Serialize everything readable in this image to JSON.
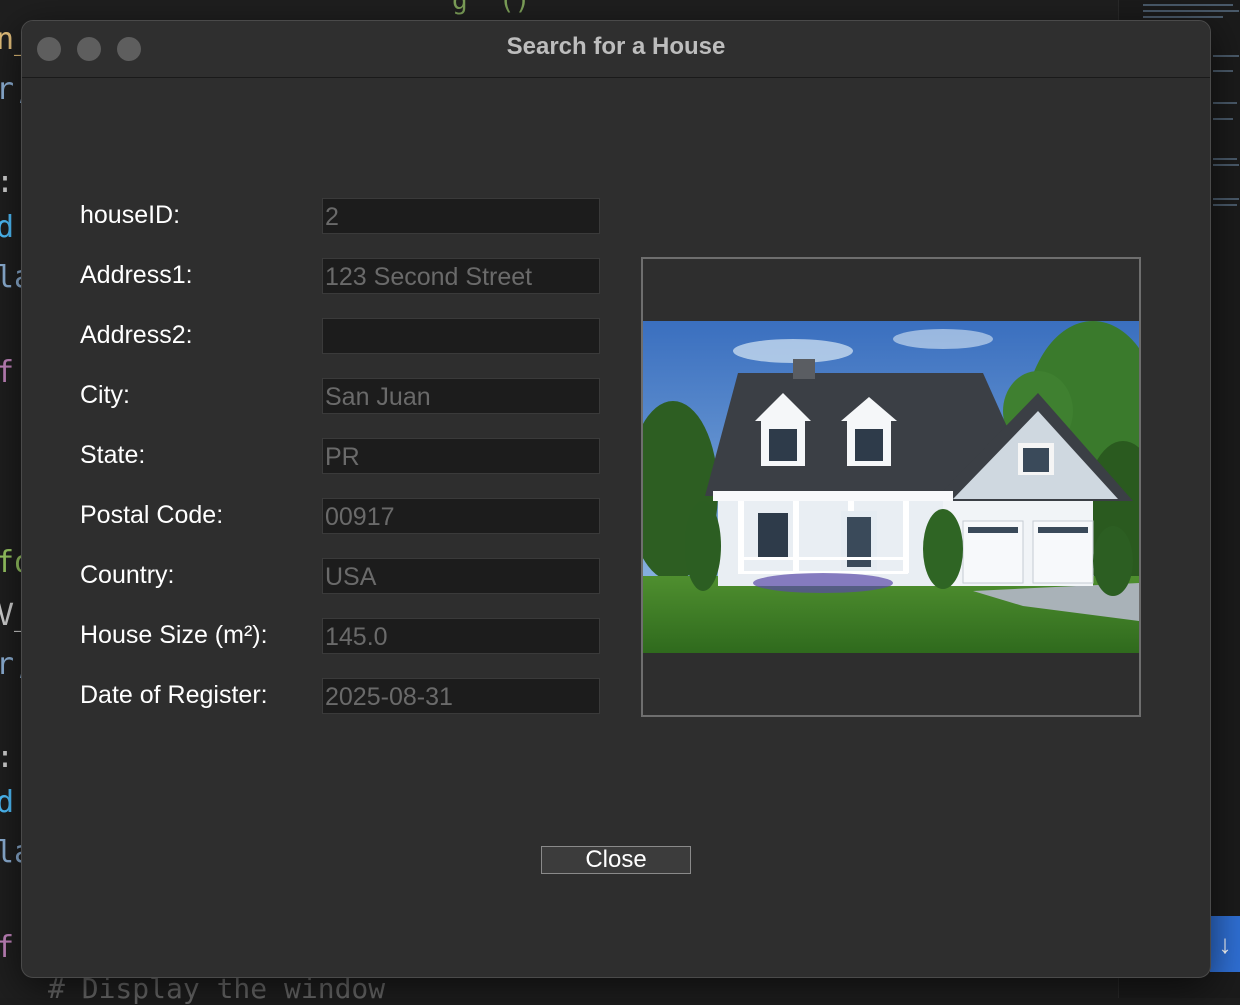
{
  "window": {
    "title": "Search for a House"
  },
  "form": {
    "fields": [
      {
        "label": "houseID:",
        "value": "2"
      },
      {
        "label": "Address1:",
        "value": "123 Second Street"
      },
      {
        "label": "Address2:",
        "value": ""
      },
      {
        "label": "City:",
        "value": "San Juan"
      },
      {
        "label": "State:",
        "value": "PR"
      },
      {
        "label": "Postal Code:",
        "value": "00917"
      },
      {
        "label": "Country:",
        "value": "USA"
      },
      {
        "label": "House Size (m²):",
        "value": "145.0"
      },
      {
        "label": "Date of Register:",
        "value": "2025-08-31"
      }
    ]
  },
  "buttons": {
    "close": "Close"
  },
  "background_editor": {
    "bottom_code": "# Display the window",
    "top_code": "g  ()",
    "scroll_icon": "arrow-down-icon"
  }
}
